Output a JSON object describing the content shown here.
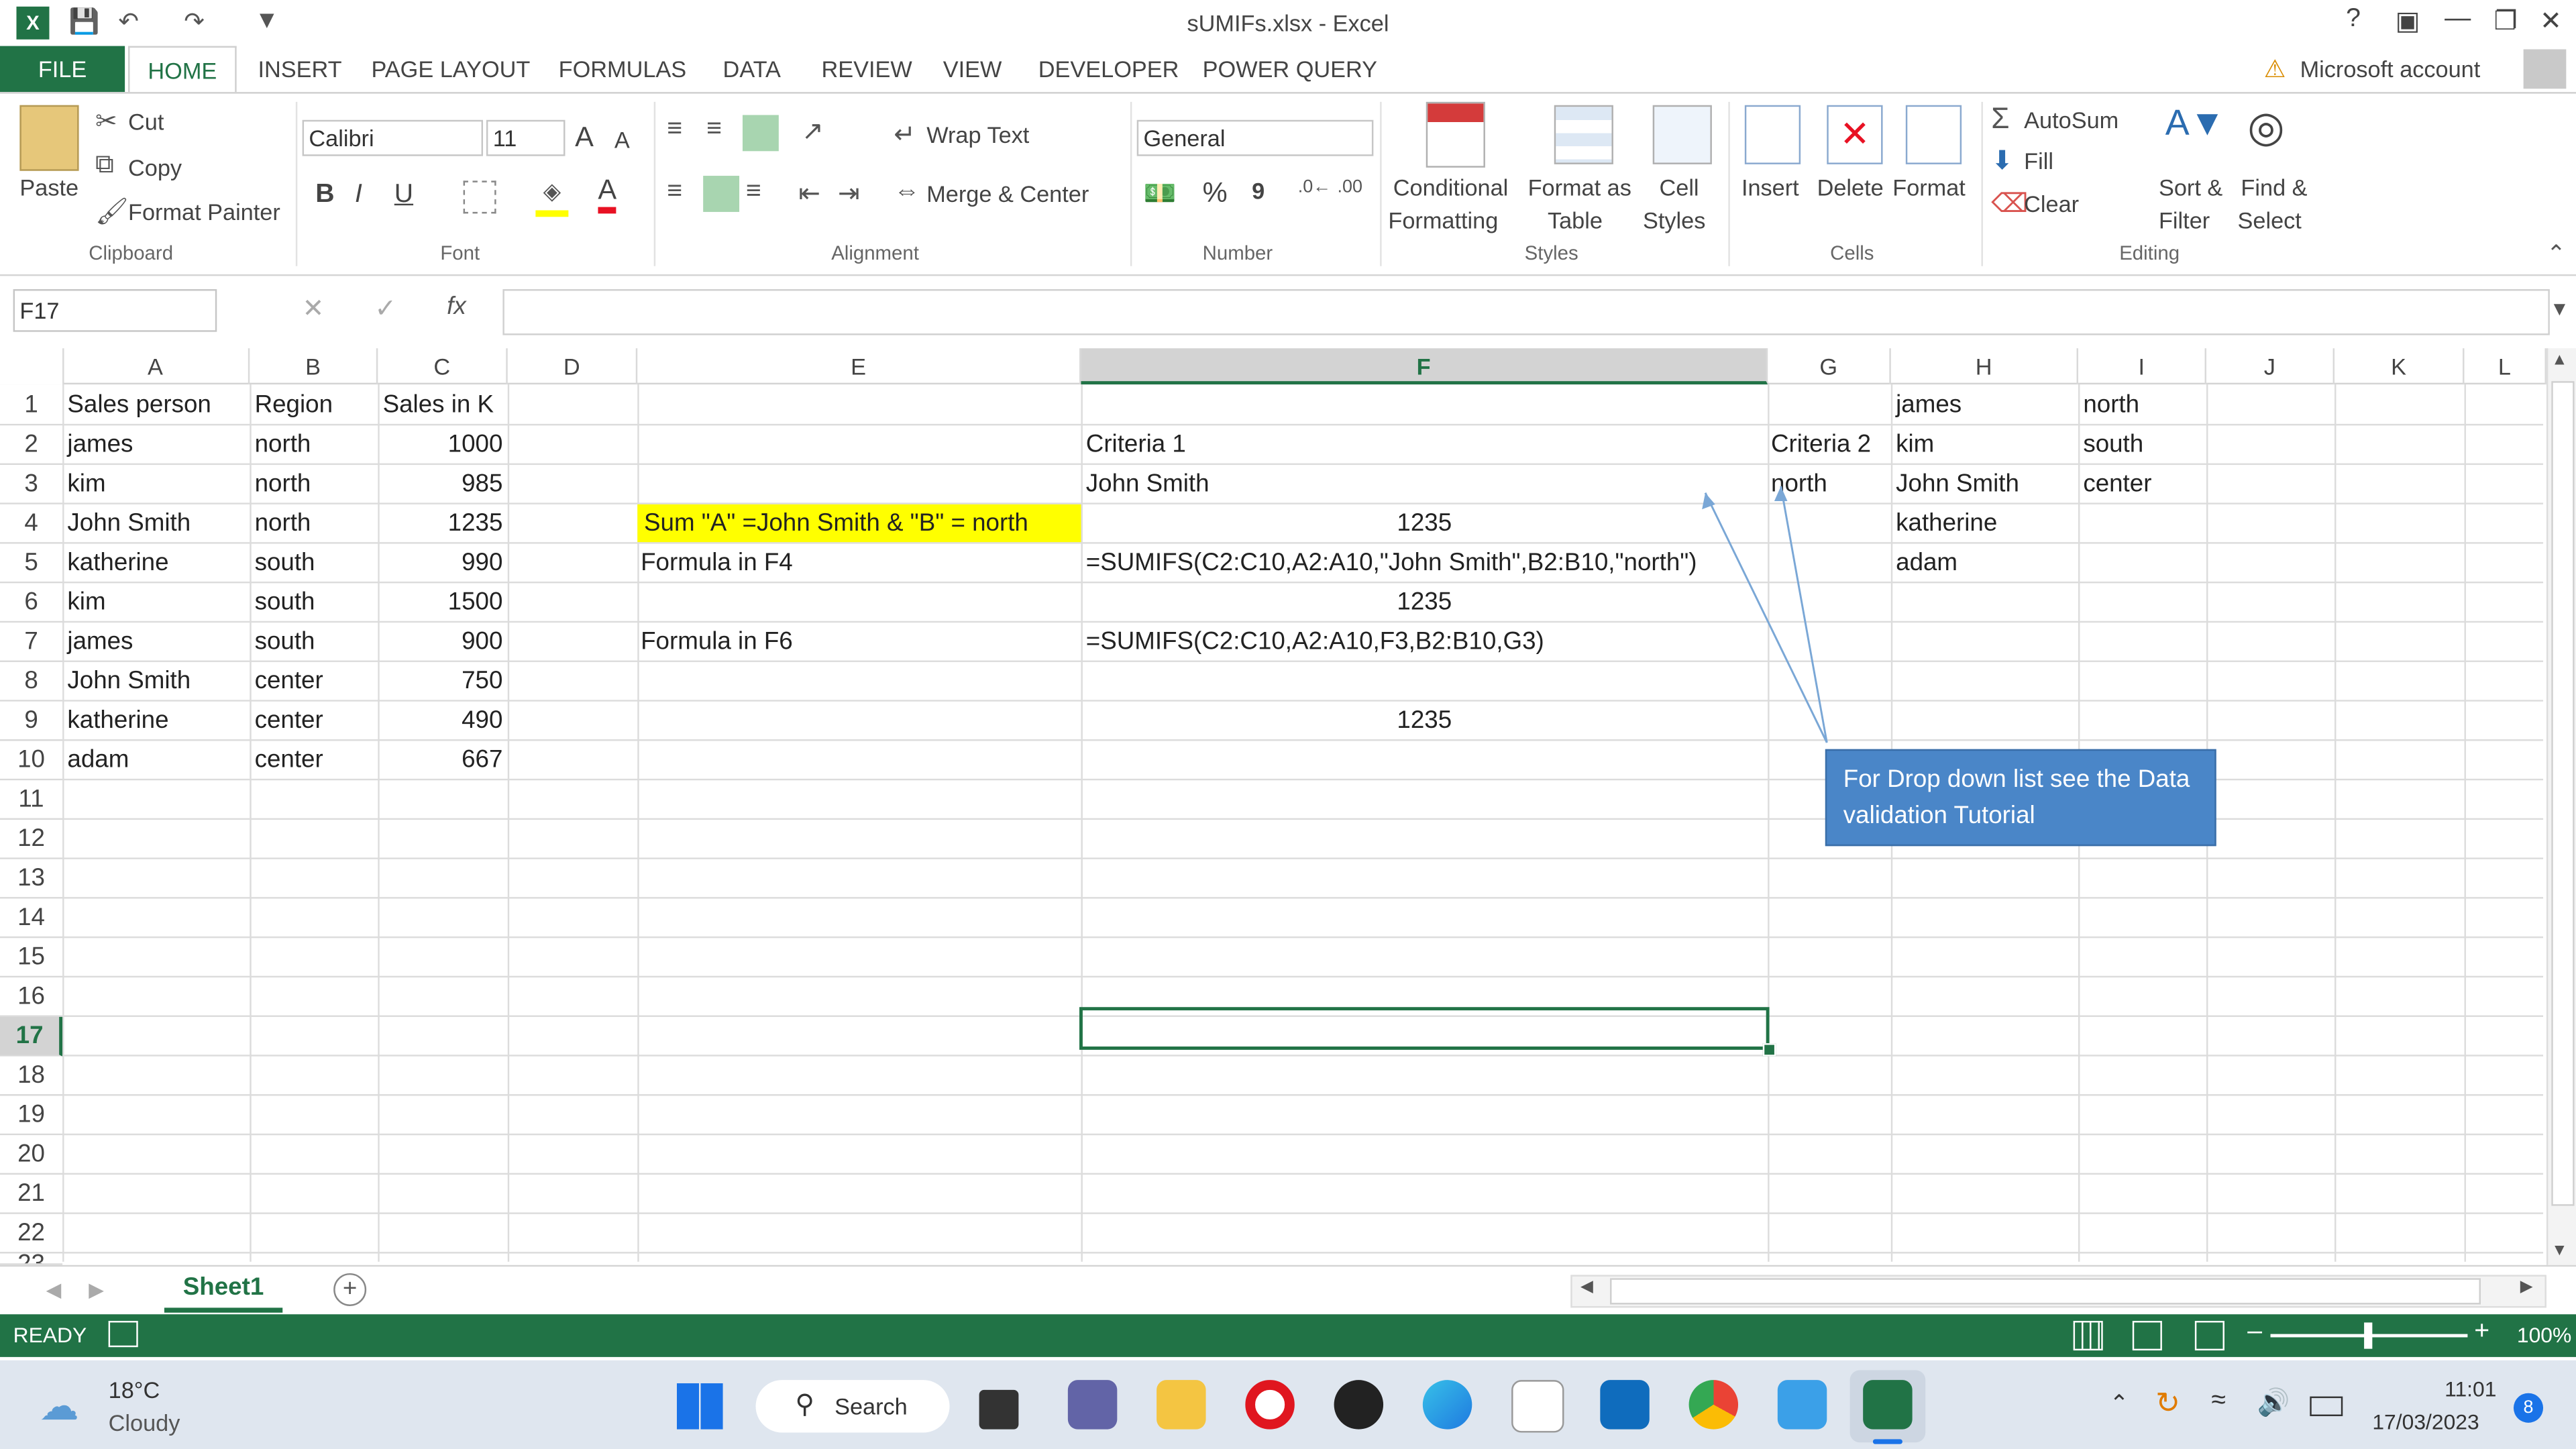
{
  "window": {
    "title": "sUMIFs.xlsx - Excel",
    "account": "Microsoft account",
    "help": "?"
  },
  "ribbon_tabs": [
    "FILE",
    "HOME",
    "INSERT",
    "PAGE LAYOUT",
    "FORMULAS",
    "DATA",
    "REVIEW",
    "VIEW",
    "DEVELOPER",
    "POWER QUERY"
  ],
  "clipboard": {
    "paste": "Paste",
    "cut": "Cut",
    "copy": "Copy",
    "format_painter": "Format Painter",
    "label": "Clipboard"
  },
  "font": {
    "name": "Calibri",
    "size": "11",
    "bold": "B",
    "italic": "I",
    "underline": "U",
    "grow": "A",
    "shrink": "A",
    "color_letter": "A",
    "label": "Font",
    "highlight_color": "#ffff00",
    "font_color": "#e81123"
  },
  "alignment": {
    "wrap_text": "Wrap Text",
    "merge_center": "Merge & Center",
    "label": "Alignment"
  },
  "number": {
    "format": "General",
    "percent": "%",
    "comma": "9",
    "label": "Number"
  },
  "styles": {
    "conditional": [
      "Conditional",
      "Formatting"
    ],
    "format_table": [
      "Format as",
      "Table"
    ],
    "cell_styles": [
      "Cell",
      "Styles"
    ],
    "label": "Styles"
  },
  "cells": {
    "insert": "Insert",
    "delete": "Delete",
    "format": "Format",
    "label": "Cells"
  },
  "editing": {
    "autosum": "AutoSum",
    "fill": "Fill",
    "clear": "Clear",
    "sort_filter": [
      "Sort &",
      "Filter"
    ],
    "find_select": [
      "Find &",
      "Select"
    ],
    "label": "Editing"
  },
  "formula_bar": {
    "name_box": "F17",
    "fx": "fx",
    "value": ""
  },
  "columns": [
    "A",
    "B",
    "C",
    "D",
    "E",
    "F",
    "G",
    "H",
    "I",
    "J",
    "K",
    "L"
  ],
  "rows": [
    "1",
    "2",
    "3",
    "4",
    "5",
    "6",
    "7",
    "8",
    "9",
    "10",
    "11",
    "12",
    "13",
    "14",
    "15",
    "16",
    "17",
    "18",
    "19",
    "20",
    "21",
    "22",
    "23"
  ],
  "active_cell": "F17",
  "table": {
    "headers": [
      "Sales person",
      "Region",
      "Sales in K"
    ],
    "rows": [
      [
        "james",
        "north",
        "1000"
      ],
      [
        "kim",
        "north",
        "985"
      ],
      [
        "John Smith",
        "north",
        "1235"
      ],
      [
        "katherine",
        "south",
        "990"
      ],
      [
        "kim",
        "south",
        "1500"
      ],
      [
        "james",
        "south",
        "900"
      ],
      [
        "John Smith",
        "center",
        "750"
      ],
      [
        "katherine",
        "center",
        "490"
      ],
      [
        "adam",
        "center",
        "667"
      ]
    ]
  },
  "extra_cells": {
    "E4": "Sum \"A\" =John Smith & \"B\" = north",
    "E5": "Formula in F4",
    "E7": "Formula in F6",
    "F2": "Criteria 1",
    "F3": "John Smith",
    "F4": "1235",
    "F5": "=SUMIFS(C2:C10,A2:A10,\"John Smith\",B2:B10,\"north\")",
    "F6": "1235",
    "F7": "=SUMIFS(C2:C10,A2:A10,F3,B2:B10,G3)",
    "F9": "1235",
    "G2": "Criteria 2",
    "G3": "north",
    "H1": "james",
    "H2": "kim",
    "H3": "John Smith",
    "H4": "katherine",
    "H5": "adam",
    "I1": "north",
    "I2": "south",
    "I3": "center"
  },
  "callout": "For Drop down list see the Data validation Tutorial",
  "sheet_tab": "Sheet1",
  "status": {
    "ready": "READY",
    "zoom": "100%"
  },
  "taskbar": {
    "temp": "18°C",
    "weather": "Cloudy",
    "search": "Search",
    "time": "11:01",
    "date": "17/03/2023",
    "badge": "8"
  },
  "colors": {
    "excel_green": "#217346",
    "callout_fill": "#4a86c8",
    "highlight": "#ffff00"
  }
}
